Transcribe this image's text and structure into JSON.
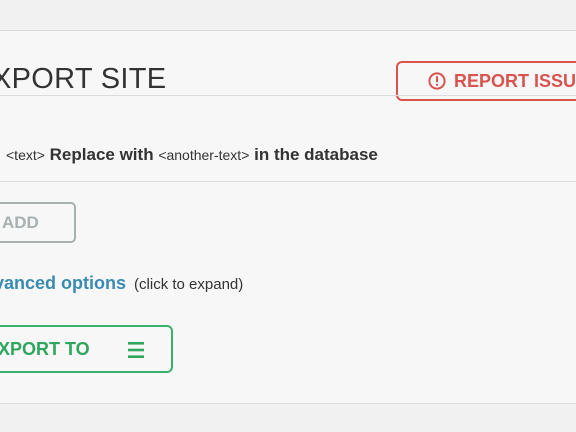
{
  "header": {
    "title": "XPORT SITE",
    "report_label": "REPORT ISSU"
  },
  "replace": {
    "search_code": "<text>",
    "replace_label": "Replace with",
    "replacement_code": "<another-text>",
    "suffix": "in the database"
  },
  "actions": {
    "add_label": "ADD",
    "advanced_link": "vanced options",
    "advanced_hint": "(click to expand)",
    "export_label": "XPORT TO"
  },
  "colors": {
    "report": "#d9534f",
    "link": "#3a8bb2",
    "export": "#2ea65d",
    "disabled": "#a7b1b1"
  },
  "icons": {
    "report": "alert-circle-icon",
    "export_menu": "menu-icon"
  }
}
